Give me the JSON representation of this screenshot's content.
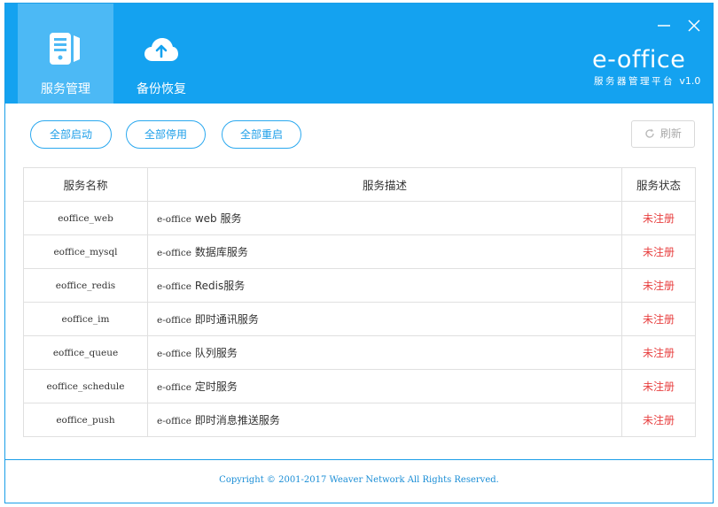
{
  "header": {
    "tabs": [
      {
        "label": "服务管理",
        "icon": "server-icon",
        "active": true
      },
      {
        "label": "备份恢复",
        "icon": "cloud-upload-icon",
        "active": false
      }
    ],
    "brand": {
      "title": "e-office",
      "subtitle": "服务器管理平台",
      "version": "v1.0"
    },
    "colors": {
      "header_bg": "#14a2f0",
      "active_tab_bg": "#4cb9f5"
    }
  },
  "toolbar": {
    "start_all": "全部启动",
    "stop_all": "全部停用",
    "restart_all": "全部重启",
    "refresh": "刷新"
  },
  "table": {
    "headers": {
      "name": "服务名称",
      "desc": "服务描述",
      "status": "服务状态"
    },
    "rows": [
      {
        "name": "eoffice_web",
        "desc_prefix": "e-office",
        "desc": "web 服务",
        "status": "未注册"
      },
      {
        "name": "eoffice_mysql",
        "desc_prefix": "e-office",
        "desc": "数据库服务",
        "status": "未注册"
      },
      {
        "name": "eoffice_redis",
        "desc_prefix": "e-office",
        "desc": "Redis服务",
        "status": "未注册"
      },
      {
        "name": "eoffice_im",
        "desc_prefix": "e-office",
        "desc": "即时通讯服务",
        "status": "未注册"
      },
      {
        "name": "eoffice_queue",
        "desc_prefix": "e-office",
        "desc": "队列服务",
        "status": "未注册"
      },
      {
        "name": "eoffice_schedule",
        "desc_prefix": "e-office",
        "desc": "定时服务",
        "status": "未注册"
      },
      {
        "name": "eoffice_push",
        "desc_prefix": "e-office",
        "desc": "即时消息推送服务",
        "status": "未注册"
      }
    ],
    "status_color": "#e84040"
  },
  "footer": {
    "copyright": "Copyright © 2001-2017 Weaver Network All Rights Reserved."
  }
}
